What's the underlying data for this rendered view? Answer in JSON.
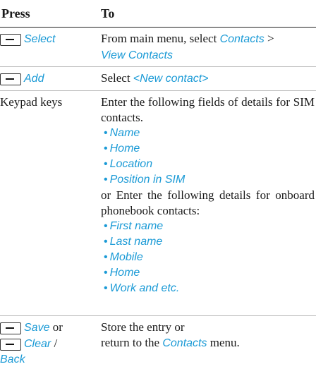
{
  "header": {
    "col1": "Press",
    "col2": "To"
  },
  "rows": [
    {
      "key_label": "Select",
      "to_prefix": "From main menu, select ",
      "to_link1": "Contacts",
      "to_sep": " >",
      "to_link2": "View Contacts"
    },
    {
      "key_label": "Add",
      "to_prefix": "Select ",
      "to_link1": "<New contact>"
    },
    {
      "press": "Keypad keys",
      "intro": "Enter the following fields of details for SIM contacts.",
      "sim_fields": [
        "Name",
        "Home",
        "Location",
        "Position in SIM"
      ],
      "middle": "or Enter the following details for onboard phonebook contacts:",
      "phonebook_fields": [
        "First name",
        "Last name",
        "Mobile",
        "Home",
        "Work and etc."
      ]
    },
    {
      "key_label1": "Save",
      "or": " or",
      "key_label2": "Clear",
      "slash": " /",
      "key_label3": "Back",
      "line1": "Store the entry or",
      "line2_prefix": "return to the ",
      "line2_link": "Contacts",
      "line2_suffix": " menu."
    }
  ],
  "bullet": "•",
  "colors": {
    "link": "#1a9ad6",
    "text": "#1a1a1a",
    "rule": "#bdbdbd"
  }
}
